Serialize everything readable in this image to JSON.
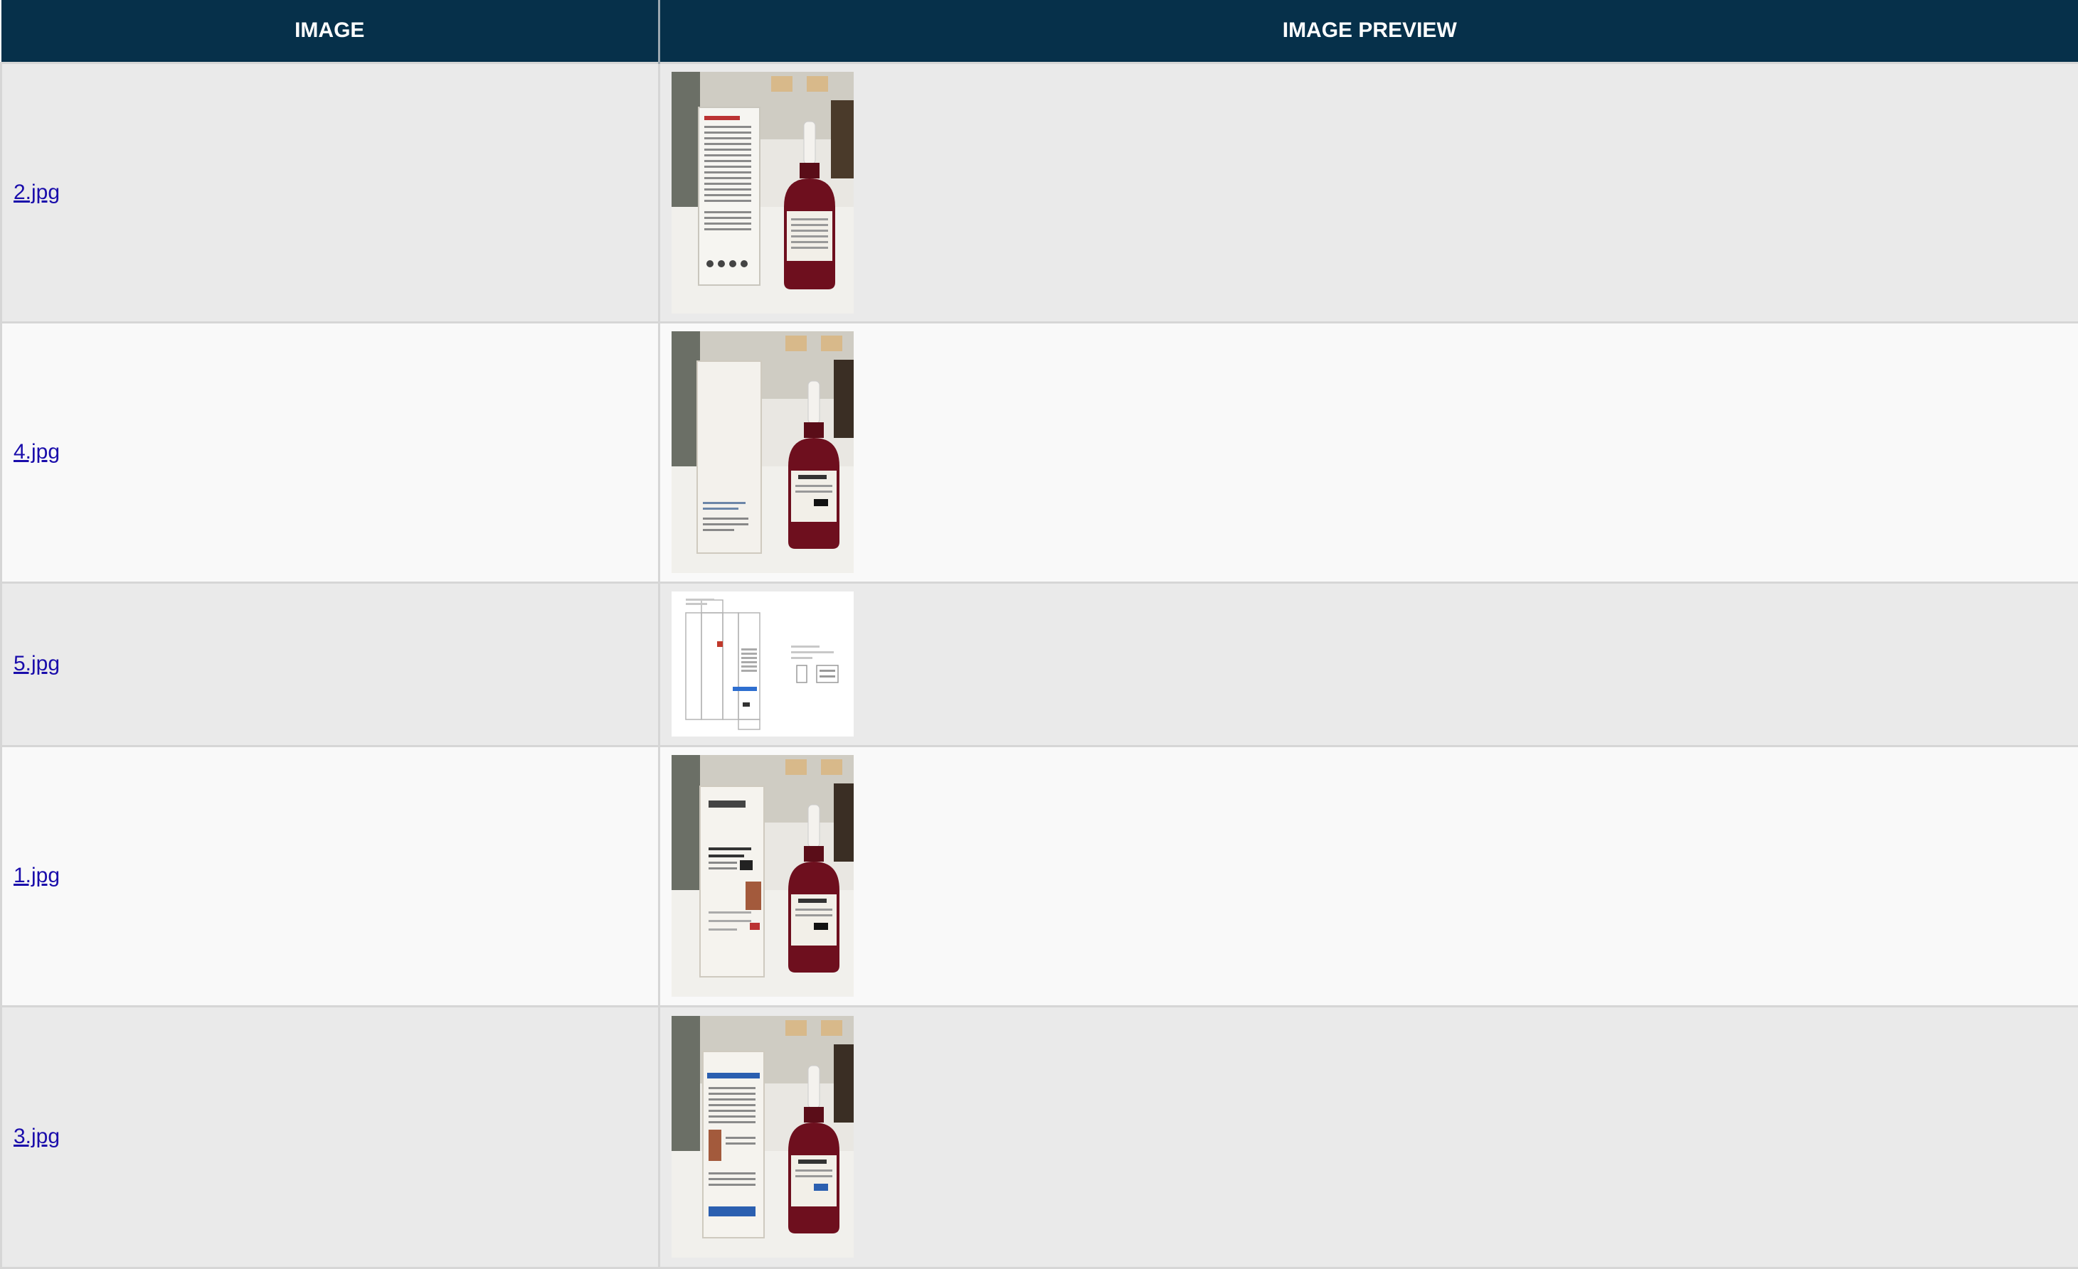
{
  "table": {
    "headers": {
      "image": "IMAGE",
      "preview": "IMAGE PREVIEW"
    },
    "rows": [
      {
        "file": "2.jpg",
        "thumb": "photo-serum-bottle-box-back-icon"
      },
      {
        "file": "4.jpg",
        "thumb": "photo-serum-bottle-plain-box-icon"
      },
      {
        "file": "5.jpg",
        "thumb": "packaging-dieline-icon"
      },
      {
        "file": "1.jpg",
        "thumb": "photo-serum-bottle-box-front-icon"
      },
      {
        "file": "3.jpg",
        "thumb": "photo-serum-bottle-box-side-icon"
      }
    ]
  },
  "colors": {
    "header_bg": "#06304a",
    "row_odd": "#eaeaea",
    "row_even": "#f9f9f9",
    "link": "#1a0dab",
    "serum": "#6e0f1e"
  }
}
